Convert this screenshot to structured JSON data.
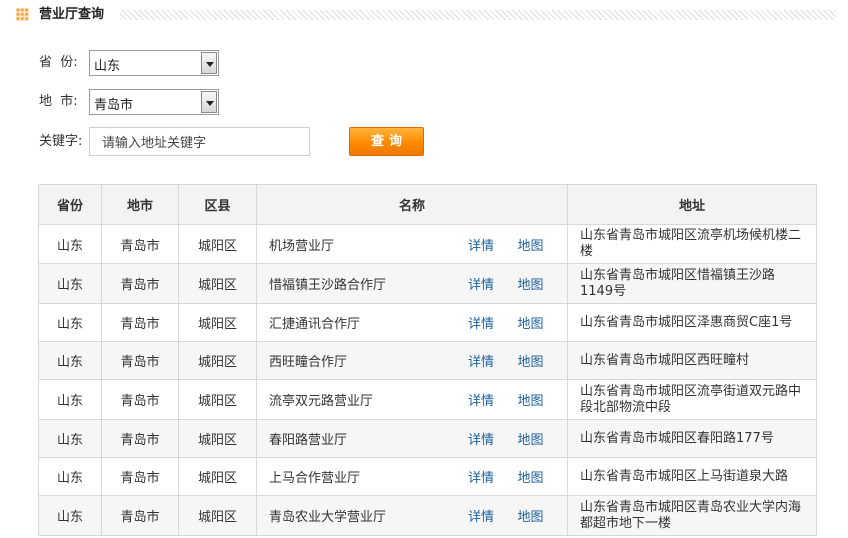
{
  "section": {
    "title": "营业厅查询"
  },
  "form": {
    "province_label": "省  份:",
    "province_value": "山东",
    "city_label": "地  市:",
    "city_value": "青岛市",
    "keyword_label": "关键字:",
    "keyword_placeholder": "请输入地址关键字",
    "query_button": "查询"
  },
  "table": {
    "headers": [
      "省份",
      "地市",
      "区县",
      "名称",
      "地址"
    ],
    "detail_link": "详情",
    "map_link": "地图",
    "rows": [
      {
        "province": "山东",
        "city": "青岛市",
        "district": "城阳区",
        "name": "机场营业厅",
        "address": "山东省青岛市城阳区流亭机场候机楼二楼"
      },
      {
        "province": "山东",
        "city": "青岛市",
        "district": "城阳区",
        "name": "惜福镇王沙路合作厅",
        "address": "山东省青岛市城阳区惜福镇王沙路1149号"
      },
      {
        "province": "山东",
        "city": "青岛市",
        "district": "城阳区",
        "name": "汇捷通讯合作厅",
        "address": "山东省青岛市城阳区泽惠商贸C座1号"
      },
      {
        "province": "山东",
        "city": "青岛市",
        "district": "城阳区",
        "name": "西旺疃合作厅",
        "address": "山东省青岛市城阳区西旺疃村"
      },
      {
        "province": "山东",
        "city": "青岛市",
        "district": "城阳区",
        "name": "流亭双元路营业厅",
        "address": "山东省青岛市城阳区流亭街道双元路中段北部物流中段"
      },
      {
        "province": "山东",
        "city": "青岛市",
        "district": "城阳区",
        "name": "春阳路营业厅",
        "address": "山东省青岛市城阳区春阳路177号"
      },
      {
        "province": "山东",
        "city": "青岛市",
        "district": "城阳区",
        "name": "上马合作营业厅",
        "address": "山东省青岛市城阳区上马街道泉大路"
      },
      {
        "province": "山东",
        "city": "青岛市",
        "district": "城阳区",
        "name": "青岛农业大学营业厅",
        "address": "山东省青岛市城阳区青岛农业大学内海都超市地下一楼"
      }
    ]
  }
}
